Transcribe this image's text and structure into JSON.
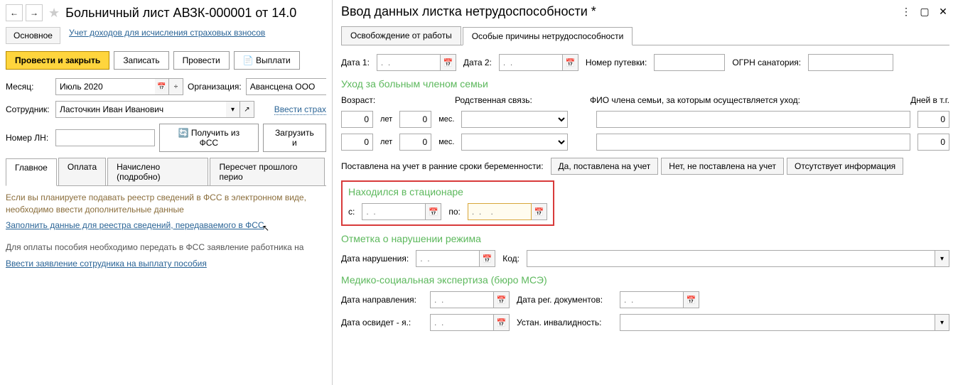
{
  "left": {
    "title": "Больничный лист АВЗК-000001 от 14.0",
    "subnav": {
      "main": "Основное",
      "link": "Учет доходов для исчисления страховых взносов"
    },
    "actions": {
      "postClose": "Провести и закрыть",
      "save": "Записать",
      "post": "Провести",
      "pay": "Выплати"
    },
    "month": {
      "label": "Месяц:",
      "value": "Июль 2020"
    },
    "org": {
      "label": "Организация:",
      "value": "Авансцена ООО"
    },
    "employee": {
      "label": "Сотрудник:",
      "value": "Ласточкин Иван Иванович",
      "enterLink": "Ввести страх"
    },
    "ln": {
      "label": "Номер ЛН:",
      "getFss": "Получить из ФСС",
      "load": "Загрузить и"
    },
    "tabs": [
      "Главное",
      "Оплата",
      "Начислено (подробно)",
      "Пересчет прошлого перио"
    ],
    "info1": "Если вы планируете подавать реестр сведений в ФСС в электронном виде, необходимо ввести дополнительные данные",
    "link1": "Заполнить данные для реестра сведений, передаваемого в ФСС",
    "info2": "Для оплаты пособия необходимо передать в ФСС заявление работника на",
    "link2": "Ввести заявление сотрудника на выплату пособия"
  },
  "right": {
    "title": "Ввод данных листка нетрудоспособности *",
    "tabs": [
      "Освобождение от работы",
      "Особые причины нетрудоспособности"
    ],
    "dates": {
      "d1": "Дата 1:",
      "d2": "Дата 2:",
      "voucher": "Номер путевки:",
      "ogrn": "ОГРН санатория:"
    },
    "care": {
      "heading": "Уход за больным членом семьи",
      "age": "Возраст:",
      "rel": "Родственная связь:",
      "fio": "ФИО члена семьи, за которым осуществляется уход:",
      "days": "Дней в т.г.",
      "years": "0",
      "yearsLbl": "лет",
      "months": "0",
      "monthsLbl": "мес.",
      "daysVal": "0"
    },
    "pregnancy": {
      "label": "Поставлена на учет в ранние сроки беременности:",
      "b1": "Да, поставлена на учет",
      "b2": "Нет, не поставлена на учет",
      "b3": "Отсутствует информация"
    },
    "hospital": {
      "heading": "Находился в стационаре",
      "from": "с:",
      "to": "по:"
    },
    "violation": {
      "heading": "Отметка о нарушении режима",
      "date": "Дата нарушения:",
      "code": "Код:"
    },
    "mse": {
      "heading": "Медико-социальная экспертиза (бюро МСЭ)",
      "dir": "Дата направления:",
      "reg": "Дата рег. документов:",
      "exam": "Дата освидет - я.:",
      "disab": "Устан. инвалидность:"
    },
    "placeholder": ".  .",
    "placeholder2": ".  .    ."
  }
}
